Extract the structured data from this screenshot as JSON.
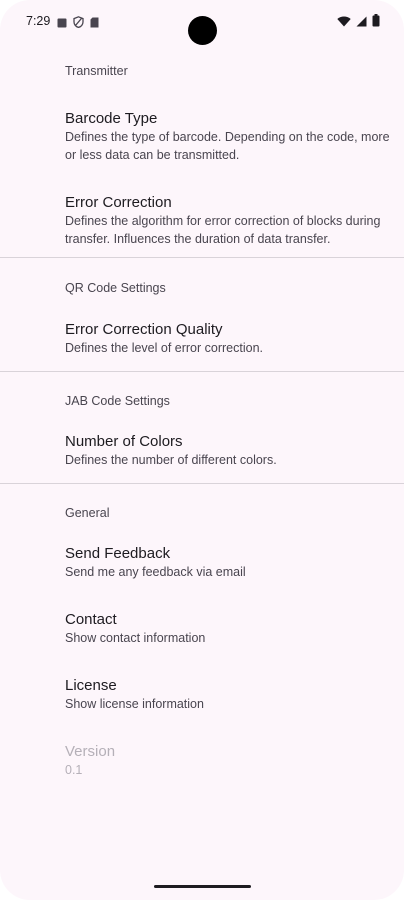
{
  "status_bar": {
    "time": "7:29"
  },
  "sections": {
    "transmitter": {
      "header": "Transmitter",
      "barcode_type": {
        "title": "Barcode Type",
        "summary": "Defines the type of barcode. Depending on the code, more or less data can be transmitted."
      },
      "error_correction": {
        "title": "Error Correction",
        "summary": "Defines the algorithm for error correction of blocks during transfer. Influences the duration of data transfer."
      }
    },
    "qr_code": {
      "header": "QR Code Settings",
      "error_correction_quality": {
        "title": "Error Correction Quality",
        "summary": "Defines the level of error correction."
      }
    },
    "jab_code": {
      "header": "JAB Code Settings",
      "number_of_colors": {
        "title": "Number of Colors",
        "summary": "Defines the number of different colors."
      }
    },
    "general": {
      "header": "General",
      "send_feedback": {
        "title": "Send Feedback",
        "summary": "Send me any feedback via email"
      },
      "contact": {
        "title": "Contact",
        "summary": "Show contact information"
      },
      "license": {
        "title": "License",
        "summary": "Show license information"
      },
      "version": {
        "title": "Version",
        "summary": "0.1"
      }
    }
  },
  "colors": {
    "background": "#fdf6fb",
    "text_primary": "#1d1b20",
    "text_secondary": "#49454f",
    "text_disabled": "#b5b0b8",
    "divider": "#d9d3d9"
  }
}
